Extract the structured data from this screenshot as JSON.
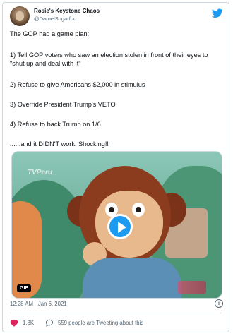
{
  "author": {
    "name": "Rosie's Keystone Chaos",
    "handle": "@DarnelSugarfoo"
  },
  "tweet": {
    "lines": [
      "The GOP had a game plan:",
      "1) Tell GOP voters who saw an election stolen in front of their eyes to \"shut up and deal with it\"",
      "2) Refuse to give Americans $2,000 in stimulus",
      "3) Override President Trump's VETO",
      "4) Refuse to back Trump on 1/6",
      "......and it DIDN'T work. Shocking!!"
    ]
  },
  "media": {
    "watermark": "TVPeru",
    "badge": "GIF"
  },
  "meta": {
    "timestamp": "12:28 AM · Jan 6, 2021"
  },
  "actions": {
    "likes": "1.8K",
    "talking": "559 people are Tweeting about this"
  },
  "colors": {
    "accent": "#1d9bf0",
    "heart": "#e0245e",
    "muted": "#536471"
  },
  "icons": [
    "twitter-bird-icon",
    "play-icon",
    "info-icon",
    "heart-icon",
    "comment-icon"
  ]
}
